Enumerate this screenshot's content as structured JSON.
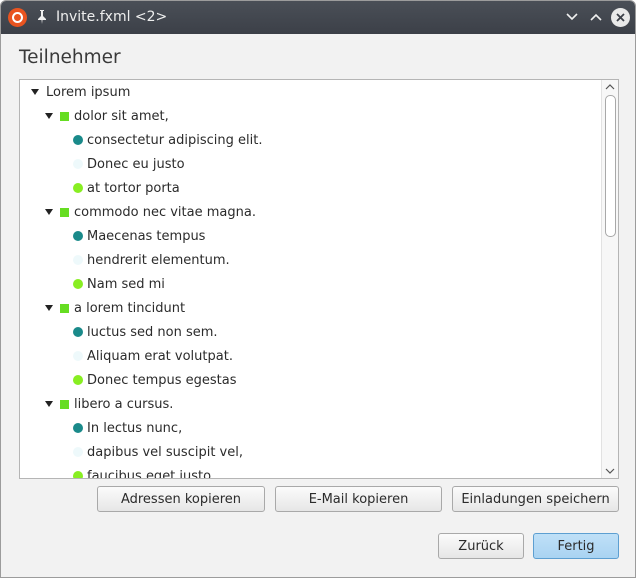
{
  "window": {
    "title": "Invite.fxml <2>"
  },
  "heading": "Teilnehmer",
  "colors": {
    "group": "#66dd22",
    "teal": "#1a8a8a",
    "green": "#88ee22",
    "pale": "#eef9fb"
  },
  "tree": [
    {
      "label": "Lorem ipsum",
      "level": 0,
      "marker": "arrow"
    },
    {
      "label": "dolor sit amet,",
      "level": 1,
      "marker": "group"
    },
    {
      "label": "consectetur adipiscing elit.",
      "level": 2,
      "marker": "teal"
    },
    {
      "label": "Donec eu justo",
      "level": 2,
      "marker": "pale"
    },
    {
      "label": "at tortor porta",
      "level": 2,
      "marker": "green"
    },
    {
      "label": "commodo nec vitae magna.",
      "level": 1,
      "marker": "group"
    },
    {
      "label": "Maecenas tempus",
      "level": 2,
      "marker": "teal"
    },
    {
      "label": "hendrerit elementum.",
      "level": 2,
      "marker": "pale"
    },
    {
      "label": "Nam sed mi",
      "level": 2,
      "marker": "green"
    },
    {
      "label": "a lorem tincidunt",
      "level": 1,
      "marker": "group"
    },
    {
      "label": "luctus sed non sem.",
      "level": 2,
      "marker": "teal"
    },
    {
      "label": "Aliquam erat volutpat.",
      "level": 2,
      "marker": "pale"
    },
    {
      "label": "Donec tempus egestas",
      "level": 2,
      "marker": "green"
    },
    {
      "label": "libero a cursus.",
      "level": 1,
      "marker": "group"
    },
    {
      "label": "In lectus nunc,",
      "level": 2,
      "marker": "teal"
    },
    {
      "label": "dapibus vel suscipit vel,",
      "level": 2,
      "marker": "pale"
    },
    {
      "label": "faucibus eget justo.",
      "level": 2,
      "marker": "green"
    }
  ],
  "actions": {
    "copy_addresses": "Adressen kopieren",
    "copy_email": "E-Mail kopieren",
    "save_invitations": "Einladungen speichern"
  },
  "footer": {
    "back": "Zurück",
    "finish": "Fertig"
  }
}
